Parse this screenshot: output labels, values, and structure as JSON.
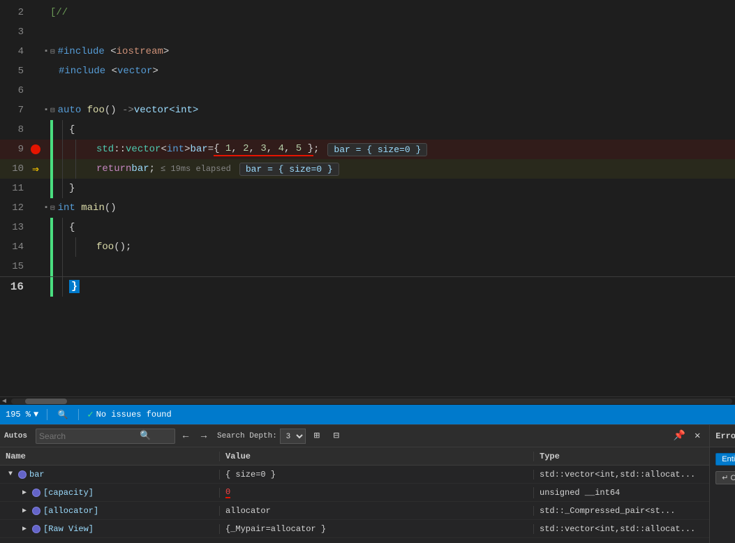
{
  "editor": {
    "lines": [
      {
        "num": 2,
        "content": "[//",
        "fold": null,
        "gutter": "none",
        "highlight": false
      },
      {
        "num": 3,
        "content": "",
        "fold": null,
        "gutter": "none",
        "highlight": false
      },
      {
        "num": 4,
        "content": "#include <iostream>",
        "fold": "collapse",
        "gutter": "none",
        "highlight": false
      },
      {
        "num": 5,
        "content": "#include <vector>",
        "fold": null,
        "gutter": "none",
        "highlight": false
      },
      {
        "num": 6,
        "content": "",
        "fold": null,
        "gutter": "none",
        "highlight": false
      },
      {
        "num": 7,
        "content": "auto foo() ->vector<int>",
        "fold": "collapse",
        "gutter": "none",
        "highlight": false
      },
      {
        "num": 8,
        "content": "{",
        "fold": null,
        "gutter": "none",
        "highlight": false
      },
      {
        "num": 9,
        "content": "    std::vector<int> bar = { 1, 2, 3, 4, 5 };",
        "fold": null,
        "gutter": "breakpoint",
        "highlight": true,
        "debugHint": "bar = { size=0 }"
      },
      {
        "num": 10,
        "content": "    return bar;",
        "fold": null,
        "gutter": "arrow",
        "highlight": true,
        "elapsed": "≤ 19ms elapsed",
        "debugHint": "bar = { size=0 }"
      },
      {
        "num": 11,
        "content": "}",
        "fold": null,
        "gutter": "none",
        "highlight": false
      },
      {
        "num": 12,
        "content": "int main()",
        "fold": "collapse",
        "gutter": "none",
        "highlight": false
      },
      {
        "num": 13,
        "content": "{",
        "fold": null,
        "gutter": "none",
        "highlight": false
      },
      {
        "num": 14,
        "content": "    foo();",
        "fold": null,
        "gutter": "none",
        "highlight": false
      },
      {
        "num": 15,
        "content": "",
        "fold": null,
        "gutter": "none",
        "highlight": false
      },
      {
        "num": 16,
        "content": "}",
        "fold": null,
        "gutter": "none",
        "highlight": false,
        "cursorLine": true
      }
    ]
  },
  "status_bar": {
    "zoom": "195 %",
    "zoom_dropdown": "▼",
    "debug_icon": "🔍",
    "no_issues": "No issues found",
    "scroll_left": "◀"
  },
  "autos_panel": {
    "title": "Autos",
    "search_placeholder": "Search",
    "search_icon": "🔍",
    "nav_back": "←",
    "nav_forward": "→",
    "depth_label": "Search Depth:",
    "depth_value": "3",
    "icon1": "⊞",
    "icon2": "⊡",
    "columns": {
      "name": "Name",
      "value": "Value",
      "type": "Type"
    },
    "rows": [
      {
        "indent": 0,
        "expanded": true,
        "icon": "obj",
        "name": "bar",
        "value": "{ size=0 }",
        "value_error": false,
        "type": "std::vector<int,std::allocat..."
      },
      {
        "indent": 1,
        "expanded": false,
        "icon": "obj",
        "name": "[capacity]",
        "value": "0",
        "value_error": true,
        "type": "unsigned __int64"
      },
      {
        "indent": 1,
        "expanded": false,
        "icon": "obj",
        "name": "[allocator]",
        "value": "allocator",
        "value_error": false,
        "type": "std::_Compressed_pair<st..."
      },
      {
        "indent": 1,
        "expanded": false,
        "icon": "obj",
        "name": "[Raw View]",
        "value": "{_Mypair=allocator }",
        "value_error": false,
        "type": "std::vector<int,std::allocat..."
      }
    ],
    "toolbar_icons": [
      "⊞",
      "⊟"
    ]
  },
  "error_list_panel": {
    "title": "Error List",
    "filter_entire_solution": "Entire Solution",
    "filter_code": "Code",
    "code_arrow": "↵"
  }
}
